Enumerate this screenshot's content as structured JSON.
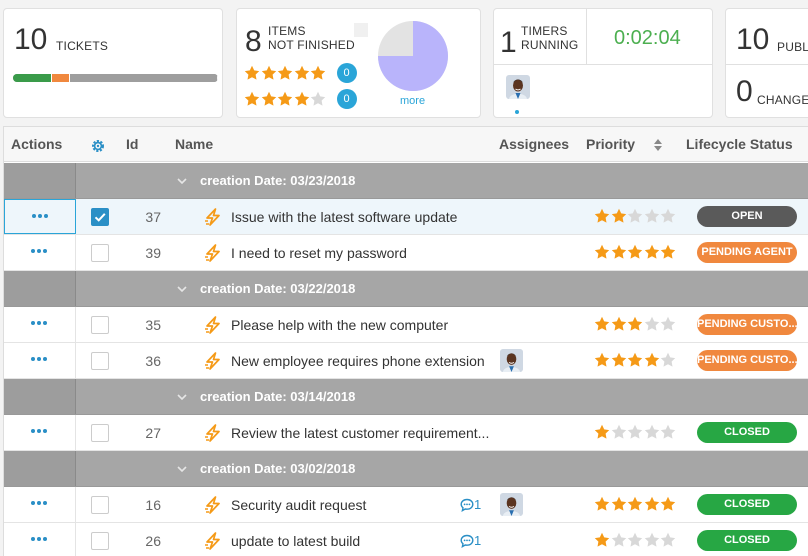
{
  "summary": {
    "tickets": {
      "count": "10",
      "label": "Tickets",
      "progress": [
        {
          "fraction": 0.19,
          "color": "#3a9b4a"
        },
        {
          "fraction": 0.09,
          "color": "#f0883e"
        },
        {
          "fraction": 0.72,
          "color": "#9e9e9e"
        }
      ]
    },
    "items": {
      "count": "8",
      "label_line1": "Items",
      "label_line2": "Not finished",
      "ratings": [
        {
          "stars": 5,
          "count": "0"
        },
        {
          "stars": 4,
          "count": "0"
        }
      ],
      "pie": {
        "filled_fraction": 0.75,
        "filled_color": "#b9b4fb",
        "rest_color": "#e3e3e3"
      },
      "more_label": "more"
    },
    "timers": {
      "count": "1",
      "label_line1": "Timers",
      "label_line2": "Running",
      "elapsed": "0:02:04"
    },
    "public": {
      "count": "10",
      "label": "Publi",
      "changes_count": "0",
      "changes_label": "Change"
    }
  },
  "grid": {
    "columns": {
      "actions": "Actions",
      "settings_icon": "gear-icon",
      "id": "Id",
      "name": "Name",
      "assignees": "Assignees",
      "priority": "Priority",
      "lifecycle": "Lifecycle Status"
    },
    "rows": [
      {
        "kind": "group",
        "label": "creation Date: 03/23/2018"
      },
      {
        "kind": "item",
        "id": "37",
        "name": "Issue with the latest software update",
        "priority": 2,
        "status": "OPEN",
        "status_color": "#5a5a5a",
        "checked": true,
        "selected": true,
        "comments": "",
        "assignee": false
      },
      {
        "kind": "item",
        "id": "39",
        "name": "I need to reset my password",
        "priority": 5,
        "status": "PENDING AGENT",
        "status_color": "#f0883e",
        "checked": false,
        "selected": false,
        "comments": "",
        "assignee": false
      },
      {
        "kind": "group",
        "label": "creation Date: 03/22/2018"
      },
      {
        "kind": "item",
        "id": "35",
        "name": "Please help with the new computer",
        "priority": 3,
        "status": "PENDING CUSTO...",
        "status_color": "#f0883e",
        "checked": false,
        "selected": false,
        "comments": "",
        "assignee": false
      },
      {
        "kind": "item",
        "id": "36",
        "name": "New employee requires phone extension",
        "priority": 4,
        "status": "PENDING CUSTO...",
        "status_color": "#f0883e",
        "checked": false,
        "selected": false,
        "comments": "",
        "assignee": true
      },
      {
        "kind": "group",
        "label": "creation Date: 03/14/2018"
      },
      {
        "kind": "item",
        "id": "27",
        "name": "Review the latest customer requirement...",
        "priority": 1,
        "status": "CLOSED",
        "status_color": "#27a744",
        "checked": false,
        "selected": false,
        "comments": "",
        "assignee": false
      },
      {
        "kind": "group",
        "label": "creation Date: 03/02/2018"
      },
      {
        "kind": "item",
        "id": "16",
        "name": "Security audit request",
        "priority": 5,
        "status": "CLOSED",
        "status_color": "#27a744",
        "checked": false,
        "selected": false,
        "comments": "1",
        "assignee": true
      },
      {
        "kind": "item",
        "id": "26",
        "name": "update to latest build",
        "priority": 1,
        "status": "CLOSED",
        "status_color": "#27a744",
        "checked": false,
        "selected": false,
        "comments": "1",
        "assignee": false
      }
    ]
  },
  "colors": {
    "accent": "#2aa5d8",
    "star_on": "#f59a17",
    "star_off": "#d8d8d8",
    "bolt": "#f59a17",
    "timer": "#4caf50"
  }
}
